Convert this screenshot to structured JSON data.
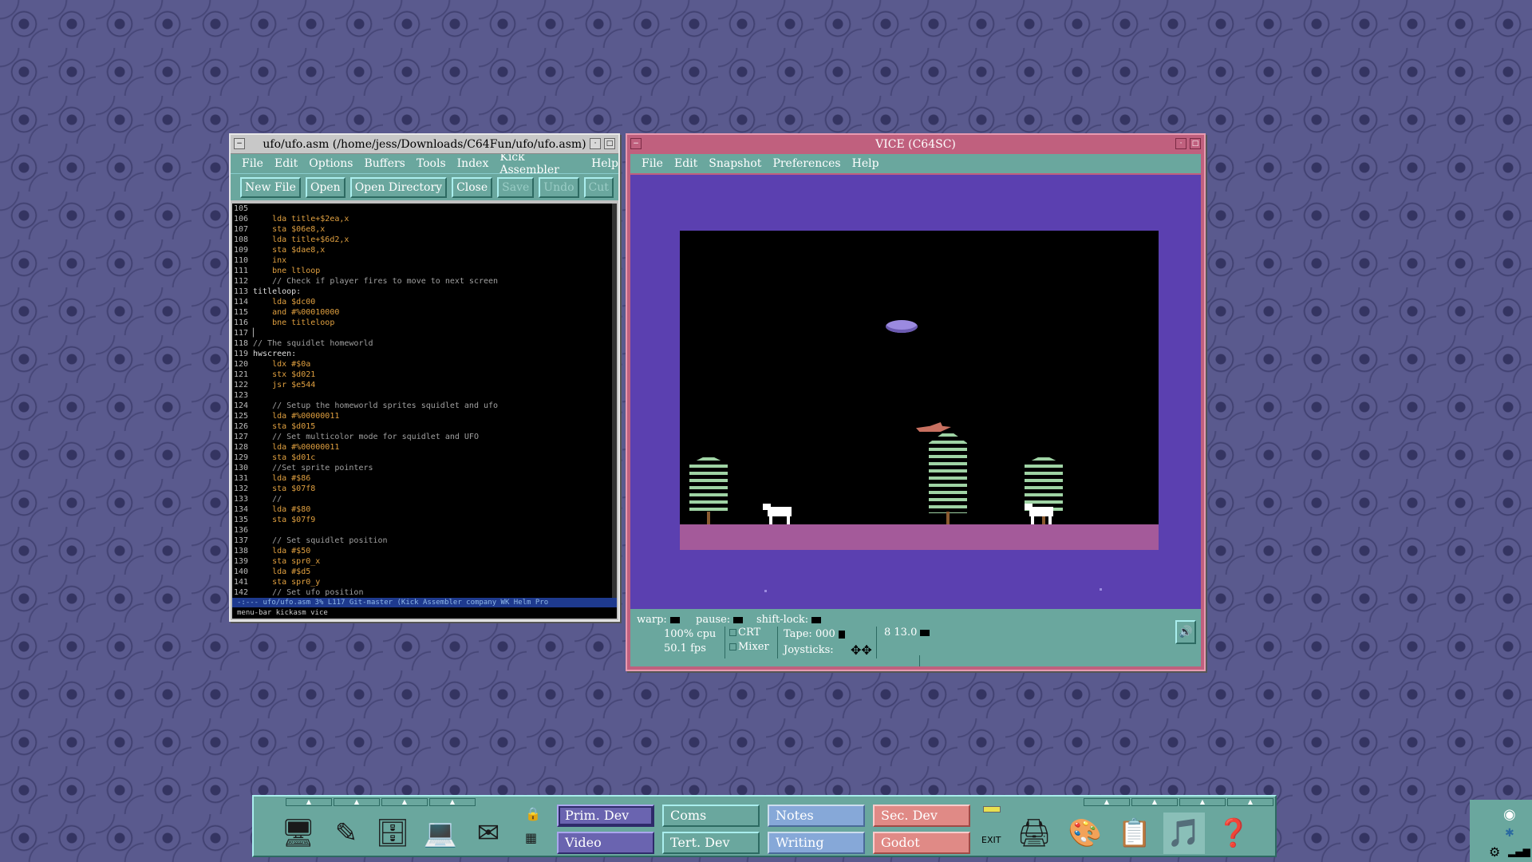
{
  "emacs": {
    "title": "ufo/ufo.asm (/home/jess/Downloads/C64Fun/ufo/ufo.asm)",
    "menu": [
      "File",
      "Edit",
      "Options",
      "Buffers",
      "Tools",
      "Index",
      "Kick Assembler",
      "Help"
    ],
    "toolbar": [
      {
        "label": "New File",
        "enabled": true
      },
      {
        "label": "Open",
        "enabled": true
      },
      {
        "label": "Open Directory",
        "enabled": true
      },
      {
        "label": "Close",
        "enabled": true
      },
      {
        "label": "Save",
        "enabled": false
      },
      {
        "label": "Undo",
        "enabled": false
      },
      {
        "label": "Cut",
        "enabled": false
      }
    ],
    "lines": [
      {
        "n": "105",
        "t": "",
        "k": "code"
      },
      {
        "n": "106",
        "t": "    lda title+$2ea,x",
        "k": "kw"
      },
      {
        "n": "107",
        "t": "    sta $06e8,x",
        "k": "kw"
      },
      {
        "n": "108",
        "t": "    lda title+$6d2,x",
        "k": "kw"
      },
      {
        "n": "109",
        "t": "    sta $dae8,x",
        "k": "kw"
      },
      {
        "n": "110",
        "t": "    inx",
        "k": "kw"
      },
      {
        "n": "111",
        "t": "    bne ltloop",
        "k": "kw"
      },
      {
        "n": "112",
        "t": "    // Check if player fires to move to next screen",
        "k": "cm"
      },
      {
        "n": "113",
        "t": "titleloop:",
        "k": "lbl"
      },
      {
        "n": "114",
        "t": "    lda $dc00",
        "k": "kw"
      },
      {
        "n": "115",
        "t": "    and #%00010000",
        "k": "kw"
      },
      {
        "n": "116",
        "t": "    bne titleloop",
        "k": "kw"
      },
      {
        "n": "117",
        "t": "▏",
        "k": "code"
      },
      {
        "n": "118",
        "t": "// The squidlet homeworld",
        "k": "cm"
      },
      {
        "n": "119",
        "t": "hwscreen:",
        "k": "lbl"
      },
      {
        "n": "120",
        "t": "    ldx #$0a",
        "k": "kw"
      },
      {
        "n": "121",
        "t": "    stx $d021",
        "k": "kw"
      },
      {
        "n": "122",
        "t": "    jsr $e544",
        "k": "kw"
      },
      {
        "n": "123",
        "t": "",
        "k": "code"
      },
      {
        "n": "124",
        "t": "    // Setup the homeworld sprites squidlet and ufo",
        "k": "cm"
      },
      {
        "n": "125",
        "t": "    lda #%00000011",
        "k": "kw"
      },
      {
        "n": "126",
        "t": "    sta $d015",
        "k": "kw"
      },
      {
        "n": "127",
        "t": "    // Set multicolor mode for squidlet and UFO",
        "k": "cm"
      },
      {
        "n": "128",
        "t": "    lda #%00000011",
        "k": "kw"
      },
      {
        "n": "129",
        "t": "    sta $d01c",
        "k": "kw"
      },
      {
        "n": "130",
        "t": "    //Set sprite pointers",
        "k": "cm"
      },
      {
        "n": "131",
        "t": "    lda #$86",
        "k": "kw"
      },
      {
        "n": "132",
        "t": "    sta $07f8",
        "k": "kw"
      },
      {
        "n": "133",
        "t": "    //",
        "k": "cm"
      },
      {
        "n": "134",
        "t": "    lda #$80",
        "k": "kw"
      },
      {
        "n": "135",
        "t": "    sta $07f9",
        "k": "kw"
      },
      {
        "n": "136",
        "t": "",
        "k": "code"
      },
      {
        "n": "137",
        "t": "    // Set squidlet position",
        "k": "cm"
      },
      {
        "n": "138",
        "t": "    lda #$50",
        "k": "kw"
      },
      {
        "n": "139",
        "t": "    sta spr0_x",
        "k": "kw"
      },
      {
        "n": "140",
        "t": "    lda #$d5",
        "k": "kw"
      },
      {
        "n": "141",
        "t": "    sta spr0_y",
        "k": "kw"
      },
      {
        "n": "142",
        "t": "    // Set ufo position",
        "k": "cm"
      }
    ],
    "modeline": "-:---  ufo/ufo.asm   3% L117  Git-master  (Kick Assembler company WK Helm Pro",
    "minibuffer": "menu-bar kickasm vice"
  },
  "vice": {
    "title": "VICE (C64SC)",
    "menu": [
      "File",
      "Edit",
      "Snapshot",
      "Preferences",
      "Help"
    ],
    "status": {
      "warp": "warp:",
      "pause": "pause:",
      "shift_lock": "shift-lock:",
      "cpu": "100% cpu",
      "fps": "50.1 fps",
      "crt": "CRT",
      "mixer": "Mixer",
      "tape": "Tape: 000",
      "joysticks": "Joysticks:",
      "drive": "8 13.0"
    },
    "colors": {
      "border": "#5b40b0",
      "screen": "#000000",
      "ground": "#a45a9a"
    }
  },
  "panel": {
    "workspaces": [
      {
        "label": "Prim. Dev",
        "style": "purple",
        "active": true
      },
      {
        "label": "Coms",
        "style": "teal",
        "active": false
      },
      {
        "label": "Notes",
        "style": "blue",
        "active": false
      },
      {
        "label": "Sec. Dev",
        "style": "red",
        "active": false
      },
      {
        "label": "Video",
        "style": "purple",
        "active": false
      },
      {
        "label": "Tert. Dev",
        "style": "teal",
        "active": false
      },
      {
        "label": "Writing",
        "style": "blue",
        "active": false
      },
      {
        "label": "Godot",
        "style": "red",
        "active": false
      }
    ],
    "exit_label": "EXIT",
    "launchers_left": [
      "globe-terminal-icon",
      "text-editor-icon",
      "file-manager-icon",
      "computer-icon",
      "mail-icon"
    ],
    "launchers_right": [
      "printer-icon",
      "paint-icon",
      "document-icon",
      "media-icon",
      "help-icon"
    ]
  }
}
